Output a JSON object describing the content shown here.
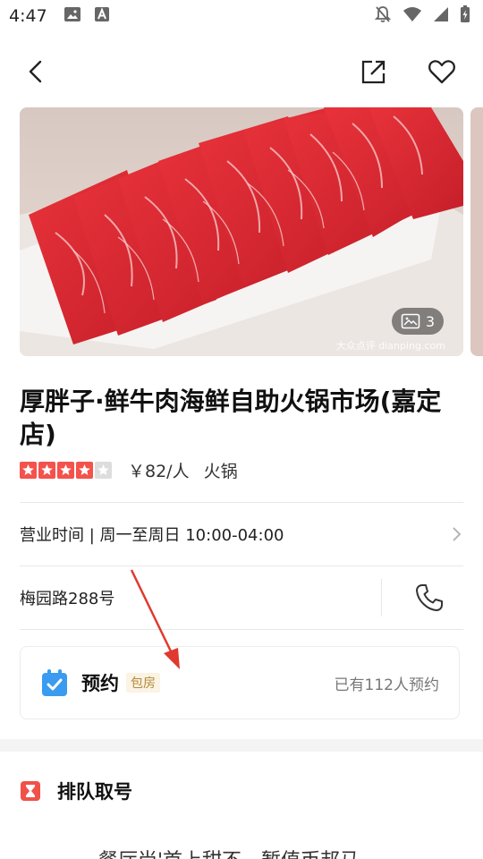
{
  "status_bar": {
    "time": "4:47",
    "left_icons": [
      "image-icon",
      "a-badge-icon"
    ],
    "right_icons": [
      "notifications-off-icon",
      "wifi-icon",
      "signal-icon",
      "battery-charging-icon"
    ]
  },
  "nav": {
    "back_icon": "chevron-left-icon",
    "share_icon": "share-icon",
    "favorite_icon": "heart-icon"
  },
  "hero": {
    "photo_count": "3",
    "watermark": "大众点评 dianping.com"
  },
  "shop": {
    "name": "厚胖子·鲜牛肉海鲜自助火锅市场(嘉定店)",
    "rating_stars": 4,
    "rating_max": 5,
    "price": "￥82/人",
    "category": "火锅",
    "hours": "营业时间 | 周一至周日 10:00-04:00",
    "address": "梅园路288号"
  },
  "booking": {
    "label": "预约",
    "tag": "包房",
    "count": "已有112人预约"
  },
  "queue": {
    "title": "排队取号",
    "partial_text": "餐厅尚'首上甜不，暂值币邦马"
  },
  "colors": {
    "star_active": "#f4524d",
    "star_inactive": "#dddddd",
    "booking_icon": "#3a9bf0",
    "queue_icon": "#f0524a",
    "arrow": "#e0392f",
    "tag_bg": "#fbf3e3",
    "tag_text": "#b38a3c"
  }
}
